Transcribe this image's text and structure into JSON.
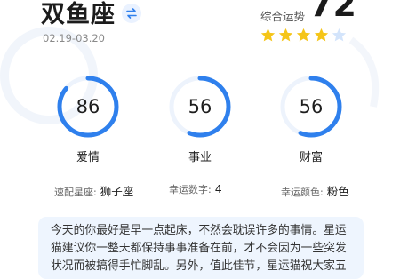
{
  "sign": {
    "name": "双鱼座",
    "date_range": "02.19-03.20"
  },
  "overall": {
    "label": "综合运势",
    "score": "72",
    "stars_filled": 4,
    "stars_total": 5
  },
  "gauges": [
    {
      "label": "爱情",
      "value": "86"
    },
    {
      "label": "事业",
      "value": "56"
    },
    {
      "label": "财富",
      "value": "56"
    }
  ],
  "details": {
    "match_label": "速配星座:",
    "match_value": "狮子座",
    "number_label": "幸运数字:",
    "number_value": "4",
    "color_label": "幸运颜色:",
    "color_value": "粉色"
  },
  "description": "今天的你最好是早一点起床，不然会耽误许多的事情。星运猫建议你一整天都保持事事准备在前，才不会因为一些突发状况而被搞得手忙脚乱。另外，值此佳节，星运猫祝大家五",
  "colors": {
    "accent": "#2f80ed",
    "star": "#f5c518",
    "star_empty": "#d3e4fb",
    "card_bg": "#eef5fe"
  }
}
